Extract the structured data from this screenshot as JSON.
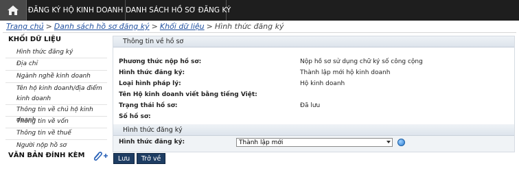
{
  "nav": {
    "home_icon": "home-icon",
    "items": [
      "ĐĂNG KÝ HỘ KINH DOANH",
      "DANH SÁCH HỒ SƠ ĐĂNG KÝ"
    ]
  },
  "breadcrumb": {
    "items": [
      "Trang chủ",
      "Danh sách hồ sơ đăng ký",
      "Khối dữ liệu"
    ],
    "current": "Hình thức đăng ký",
    "separator": ">"
  },
  "sidebar": {
    "title": "KHỐI DỮ LIỆU",
    "items": [
      "Hình thức đăng ký",
      "Địa chỉ",
      "Ngành nghề kinh doanh",
      "Tên hộ kinh doanh/địa điểm kinh doanh",
      "Thông tin về chủ hộ kinh doanh",
      "Thông tin về vốn",
      "Thông tin về thuế",
      "Người nộp hồ sơ"
    ],
    "attachments_title": "VĂN BẢN ĐÍNH KÈM",
    "attach_icon": "paperclip-plus-icon"
  },
  "info_section": {
    "title": "Thông tin về hồ sơ",
    "rows": [
      {
        "label": "Phương thức nộp hồ sơ:",
        "value": "Nộp hồ sơ sử dụng chữ ký số công cộng"
      },
      {
        "label": "Hình thức đăng ký:",
        "value": "Thành lập mới hộ kinh doanh"
      },
      {
        "label": "Loại hình pháp lý:",
        "value": "Hộ kinh doanh"
      },
      {
        "label": "Tên Hộ kinh doanh viết bằng tiếng Việt:",
        "value": ""
      },
      {
        "label": "Trạng thái hồ sơ:",
        "value": "Đã lưu"
      },
      {
        "label": "Số hồ sơ:",
        "value": ""
      }
    ]
  },
  "reg_section": {
    "title": "Hình thức đăng ký",
    "field_label": "Hình thức đăng ký:",
    "selected": "Thành lập mới",
    "info_icon": "info-icon"
  },
  "buttons": {
    "save": "Lưu",
    "back": "Trở về"
  },
  "colors": {
    "nav_bg": "#1e1e1e",
    "link": "#1f4f9f",
    "button_bg": "#1e3d63",
    "panel_bg": "#f0f3f6"
  }
}
